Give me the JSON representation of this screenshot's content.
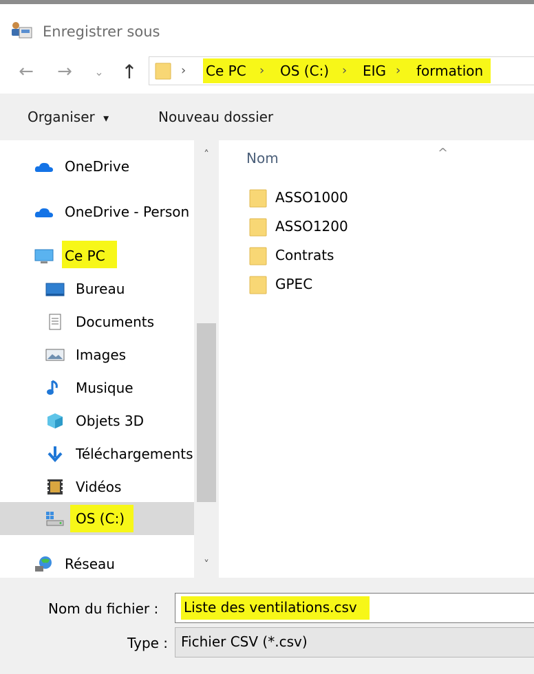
{
  "window": {
    "title": "Enregistrer sous"
  },
  "navigation": {
    "back_glyph": "←",
    "forward_glyph": "→",
    "recent_glyph": "⌄",
    "up_glyph": "↑",
    "crumb_sep": "›",
    "breadcrumb": [
      "Ce PC",
      "OS (C:)",
      "EIG",
      "formation"
    ]
  },
  "toolbar": {
    "organize_label": "Organiser",
    "organize_caret": "▾",
    "new_folder_label": "Nouveau dossier"
  },
  "sidebar": {
    "items": [
      {
        "label": "OneDrive",
        "icon": "cloud-icon"
      },
      {
        "label": "OneDrive - Person",
        "icon": "cloud-icon"
      },
      {
        "label": "Ce PC",
        "icon": "computer-icon"
      },
      {
        "label": "Bureau",
        "icon": "desktop-icon"
      },
      {
        "label": "Documents",
        "icon": "document-icon"
      },
      {
        "label": "Images",
        "icon": "picture-icon"
      },
      {
        "label": "Musique",
        "icon": "music-icon"
      },
      {
        "label": "Objets 3D",
        "icon": "cube-icon"
      },
      {
        "label": "Téléchargements",
        "icon": "download-icon"
      },
      {
        "label": "Vidéos",
        "icon": "video-icon"
      },
      {
        "label": "OS (C:)",
        "icon": "drive-icon",
        "selected": true
      },
      {
        "label": "Réseau",
        "icon": "network-icon"
      }
    ]
  },
  "scrollbar": {
    "up_glyph": "˄",
    "down_glyph": "˅"
  },
  "file_list": {
    "column_header": "Nom",
    "sort_glyph": "^",
    "items": [
      {
        "name": "ASSO1000",
        "type": "folder"
      },
      {
        "name": "ASSO1200",
        "type": "folder"
      },
      {
        "name": "Contrats",
        "type": "folder"
      },
      {
        "name": "GPEC",
        "type": "folder"
      }
    ]
  },
  "save_form": {
    "filename_label": "Nom du fichier :",
    "filename_value": "Liste des ventilations.csv",
    "type_label": "Type :",
    "type_value": "Fichier CSV (*.csv)"
  },
  "colors": {
    "highlight": "#f7f718",
    "folder": "#f8d775",
    "onedrive": "#1473e6",
    "selected_bg": "#d9d9d9",
    "toolbar_bg": "#f0f0f0"
  }
}
